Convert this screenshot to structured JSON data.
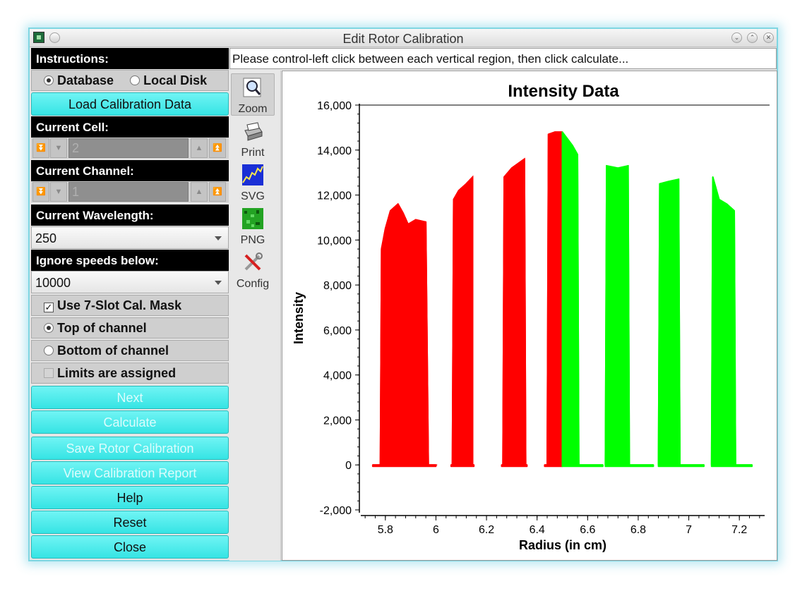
{
  "window": {
    "title": "Edit Rotor Calibration"
  },
  "left": {
    "instructions_label": "Instructions:",
    "source_database": "Database",
    "source_local_disk": "Local Disk",
    "load_button": "Load Calibration Data",
    "current_cell_label": "Current Cell:",
    "current_cell_value": "2",
    "current_channel_label": "Current Channel:",
    "current_channel_value": "1",
    "current_wavelength_label": "Current Wavelength:",
    "current_wavelength_value": "250",
    "ignore_speeds_label": "Ignore speeds below:",
    "ignore_speeds_value": "10000",
    "use_mask_label": "Use 7-Slot Cal. Mask",
    "top_channel_label": "Top of channel",
    "bottom_channel_label": "Bottom of channel",
    "limits_label": "Limits are assigned",
    "buttons": {
      "next": "Next",
      "calculate": "Calculate",
      "save": "Save Rotor Calibration",
      "view_report": "View Calibration Report",
      "help": "Help",
      "reset": "Reset",
      "close": "Close"
    }
  },
  "instructions_text": "Please control-left click between each vertical region, then click calculate...",
  "toolbar": {
    "zoom": "Zoom",
    "print": "Print",
    "svg": "SVG",
    "png": "PNG",
    "config": "Config"
  },
  "chart_data": {
    "type": "area",
    "title": "Intensity Data",
    "xlabel": "Radius (in cm)",
    "ylabel": "Intensity",
    "xlim": [
      5.7,
      7.3
    ],
    "ylim": [
      -2000,
      16000
    ],
    "xticks": [
      "5.8",
      "6",
      "6.2",
      "6.4",
      "6.6",
      "6.8",
      "7",
      "7.2"
    ],
    "yticks": [
      "-2,000",
      "0",
      "2,000",
      "4,000",
      "6,000",
      "8,000",
      "10,000",
      "12,000",
      "14,000",
      "16,000"
    ],
    "colors": {
      "selected": "#ff0000",
      "unselected": "#00ff00"
    },
    "series": [
      {
        "name": "Red",
        "color": "#ff0000",
        "lower": [
          [
            5.75,
            0
          ],
          [
            5.78,
            0
          ],
          [
            5.785,
            8200
          ],
          [
            5.8,
            9800
          ],
          [
            5.83,
            10700
          ],
          [
            5.87,
            10500
          ],
          [
            5.9,
            10200
          ],
          [
            5.93,
            10300
          ],
          [
            5.96,
            10100
          ],
          [
            5.97,
            0
          ],
          [
            6.0,
            0
          ],
          [
            6.005,
            0
          ]
        ],
        "upper": [
          [
            5.75,
            0
          ],
          [
            5.78,
            0
          ],
          [
            5.785,
            9600
          ],
          [
            5.8,
            10500
          ],
          [
            5.82,
            11300
          ],
          [
            5.85,
            11600
          ],
          [
            5.87,
            11200
          ],
          [
            5.89,
            10700
          ],
          [
            5.92,
            10900
          ],
          [
            5.96,
            10800
          ],
          [
            5.97,
            0
          ],
          [
            6.0,
            0
          ]
        ]
      },
      {
        "name": "Red",
        "color": "#ff0000",
        "lower": [
          [
            6.06,
            0
          ],
          [
            6.065,
            0
          ],
          [
            6.07,
            11300
          ],
          [
            6.1,
            11800
          ],
          [
            6.14,
            11500
          ],
          [
            6.145,
            0
          ],
          [
            6.15,
            0
          ]
        ],
        "upper": [
          [
            6.06,
            0
          ],
          [
            6.065,
            0
          ],
          [
            6.07,
            11800
          ],
          [
            6.09,
            12200
          ],
          [
            6.12,
            12500
          ],
          [
            6.145,
            12800
          ],
          [
            6.145,
            0
          ],
          [
            6.15,
            0
          ]
        ]
      },
      {
        "name": "Red",
        "color": "#ff0000",
        "lower": [
          [
            6.26,
            0
          ],
          [
            6.265,
            0
          ],
          [
            6.27,
            12300
          ],
          [
            6.3,
            12700
          ],
          [
            6.35,
            12800
          ],
          [
            6.355,
            0
          ],
          [
            6.36,
            0
          ]
        ],
        "upper": [
          [
            6.26,
            0
          ],
          [
            6.265,
            0
          ],
          [
            6.27,
            12800
          ],
          [
            6.3,
            13200
          ],
          [
            6.35,
            13600
          ],
          [
            6.355,
            0
          ],
          [
            6.36,
            0
          ]
        ]
      },
      {
        "name": "Red",
        "color": "#ff0000",
        "lower": [
          [
            6.43,
            0
          ],
          [
            6.44,
            0
          ],
          [
            6.445,
            14200
          ],
          [
            6.47,
            14000
          ],
          [
            6.5,
            14100
          ]
        ],
        "upper": [
          [
            6.43,
            0
          ],
          [
            6.44,
            0
          ],
          [
            6.445,
            14700
          ],
          [
            6.47,
            14800
          ],
          [
            6.5,
            14800
          ]
        ]
      },
      {
        "name": "Green",
        "color": "#00ff00",
        "lower": [
          [
            6.5,
            14100
          ],
          [
            6.52,
            14000
          ],
          [
            6.54,
            13700
          ],
          [
            6.56,
            13500
          ],
          [
            6.565,
            0
          ],
          [
            6.6,
            0
          ],
          [
            6.66,
            0
          ]
        ],
        "upper": [
          [
            6.5,
            14800
          ],
          [
            6.52,
            14500
          ],
          [
            6.54,
            14200
          ],
          [
            6.56,
            13800
          ],
          [
            6.565,
            0
          ],
          [
            6.6,
            0
          ],
          [
            6.66,
            0
          ]
        ]
      },
      {
        "name": "Green",
        "color": "#00ff00",
        "lower": [
          [
            6.67,
            0
          ],
          [
            6.675,
            12700
          ],
          [
            6.72,
            12500
          ],
          [
            6.76,
            12600
          ],
          [
            6.765,
            0
          ],
          [
            6.8,
            0
          ],
          [
            6.86,
            0
          ]
        ],
        "upper": [
          [
            6.67,
            0
          ],
          [
            6.675,
            13300
          ],
          [
            6.72,
            13200
          ],
          [
            6.76,
            13300
          ],
          [
            6.765,
            0
          ],
          [
            6.8,
            0
          ],
          [
            6.86,
            0
          ]
        ]
      },
      {
        "name": "Green",
        "color": "#00ff00",
        "lower": [
          [
            6.88,
            0
          ],
          [
            6.885,
            12100
          ],
          [
            6.92,
            12000
          ],
          [
            6.96,
            12200
          ],
          [
            6.965,
            0
          ],
          [
            7.0,
            0
          ],
          [
            7.06,
            0
          ]
        ],
        "upper": [
          [
            6.88,
            0
          ],
          [
            6.885,
            12500
          ],
          [
            6.92,
            12600
          ],
          [
            6.96,
            12700
          ],
          [
            6.965,
            0
          ],
          [
            7.0,
            0
          ],
          [
            7.06,
            0
          ]
        ]
      },
      {
        "name": "Green",
        "color": "#00ff00",
        "lower": [
          [
            7.09,
            0
          ],
          [
            7.095,
            11600
          ],
          [
            7.12,
            11200
          ],
          [
            7.15,
            11000
          ],
          [
            7.18,
            10900
          ],
          [
            7.185,
            0
          ],
          [
            7.22,
            0
          ],
          [
            7.25,
            0
          ]
        ],
        "upper": [
          [
            7.09,
            0
          ],
          [
            7.095,
            12800
          ],
          [
            7.12,
            11800
          ],
          [
            7.15,
            11600
          ],
          [
            7.18,
            11300
          ],
          [
            7.185,
            0
          ],
          [
            7.22,
            0
          ],
          [
            7.25,
            0
          ]
        ]
      }
    ]
  }
}
